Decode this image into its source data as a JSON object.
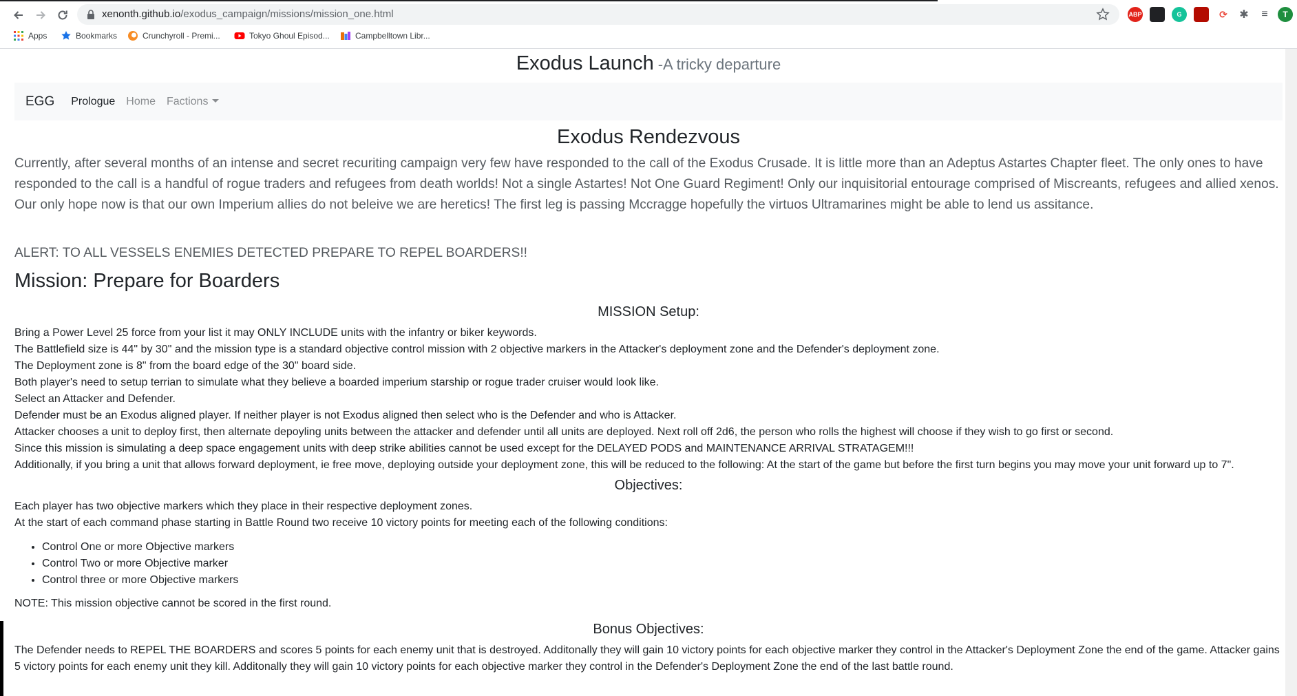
{
  "browser": {
    "url_domain": "xenonth.github.io",
    "url_path": "/exodus_campaign/missions/mission_one.html",
    "bookmarks": [
      {
        "label": "Apps",
        "icon": "apps-grid-icon"
      },
      {
        "label": "Bookmarks",
        "icon": "star-icon"
      },
      {
        "label": "Crunchyroll - Premi...",
        "icon": "crunchyroll-icon"
      },
      {
        "label": "Tokyo Ghoul Episod...",
        "icon": "youtube-icon"
      },
      {
        "label": "Campbelltown Libr...",
        "icon": "library-icon"
      }
    ],
    "extensions": [
      {
        "label": "ABP",
        "color": "#e2231a"
      },
      {
        "label": "",
        "color": "#202124"
      },
      {
        "label": "G",
        "color": "#15c39a"
      },
      {
        "label": "",
        "color": "#b30b00"
      },
      {
        "label": "",
        "color": "#ea4335"
      }
    ],
    "profile_initial": "T",
    "profile_color": "#1e8e3e"
  },
  "site": {
    "title": "Exodus Launch",
    "subtitle": "-A tricky departure",
    "nav": {
      "brand": "EGG",
      "items": [
        {
          "label": "Prologue",
          "active": true
        },
        {
          "label": "Home",
          "active": false
        },
        {
          "label": "Factions",
          "active": false
        }
      ]
    }
  },
  "content": {
    "section_title": "Exodus Rendezvous",
    "lead": "Currently, after several months of an intense and secret recuriting campaign very few have responded to the call of the Exodus Crusade. It is little more than an Adeptus Astartes Chapter fleet. The only ones to have responded to the call is a handful of rogue traders and refugees from death worlds! Not a single Astartes! Not One Guard Regiment! Only our inquisitorial entourage comprised of Miscreants, refugees and allied xenos. Our only hope now is that our own Imperium allies do not beleive we are heretics! The first leg is passing Mccragge hopefully the virtuos Ultramarines might be able to lend us assitance.",
    "alert": "ALERT: TO ALL VESSELS ENEMIES DETECTED PREPARE TO REPEL BOARDERS!!",
    "mission_title": "Mission: Prepare for Boarders",
    "setup_heading": "MISSION Setup:",
    "setup_lines": [
      "Bring a Power Level 25 force from your list it may ONLY INCLUDE units with the infantry or biker keywords.",
      "The Battlefield size is 44\" by 30\" and the mission type is a standard objective control mission with 2 objective markers in the Attacker's deployment zone and the Defender's deployment zone.",
      "The Deployment zone is 8\" from the board edge of the 30\" board side.",
      "Both player's need to setup terrian to simulate what they believe a boarded imperium starship or rogue trader cruiser would look like.",
      "Select an Attacker and Defender.",
      "Defender must be an Exodus aligned player. If neither player is not Exodus aligned then select who is the Defender and who is Attacker.",
      "Attacker chooses a unit to deploy first, then alternate depoyling units between the attacker and defender until all units are deployed. Next roll off 2d6, the person who rolls the highest will choose if they wish to go first or second.",
      "Since this mission is simulating a deep space engagement units with deep strike abilities cannot be used except for the DELAYED PODS and MAINTENANCE ARRIVAL STRATAGEM!!!",
      "Additionally, if you bring a unit that allows forward deployment, ie free move, deploying outside your deployment zone, this will be reduced to the following: At the start of the game but before the first turn begins you may move your unit forward up to 7\"."
    ],
    "objectives_heading": "Objectives:",
    "objectives_lines": [
      "Each player has two objective markers which they place in their respective deployment zones.",
      "At the start of each command phase starting in Battle Round two receive 10 victory points for meeting each of the following conditions:"
    ],
    "objectives_list": [
      "Control One or more Objective markers",
      "Control Two or more Objective marker",
      "Control three or more Objective markers"
    ],
    "note": "NOTE: This mission objective cannot be scored in the first round.",
    "bonus_heading": "Bonus Objectives:",
    "bonus": "The Defender needs to REPEL THE BOARDERS and scores 5 points for each enemy unit that is destroyed. Additonally they will gain 10 victory points for each objective marker they control in the Attacker's Deployment Zone the end of the game. Attacker gains 5 victory points for each enemy unit they kill. Additonally they will gain 10 victory points for each objective marker they control in the Defender's Deployment Zone the end of the last battle round."
  }
}
